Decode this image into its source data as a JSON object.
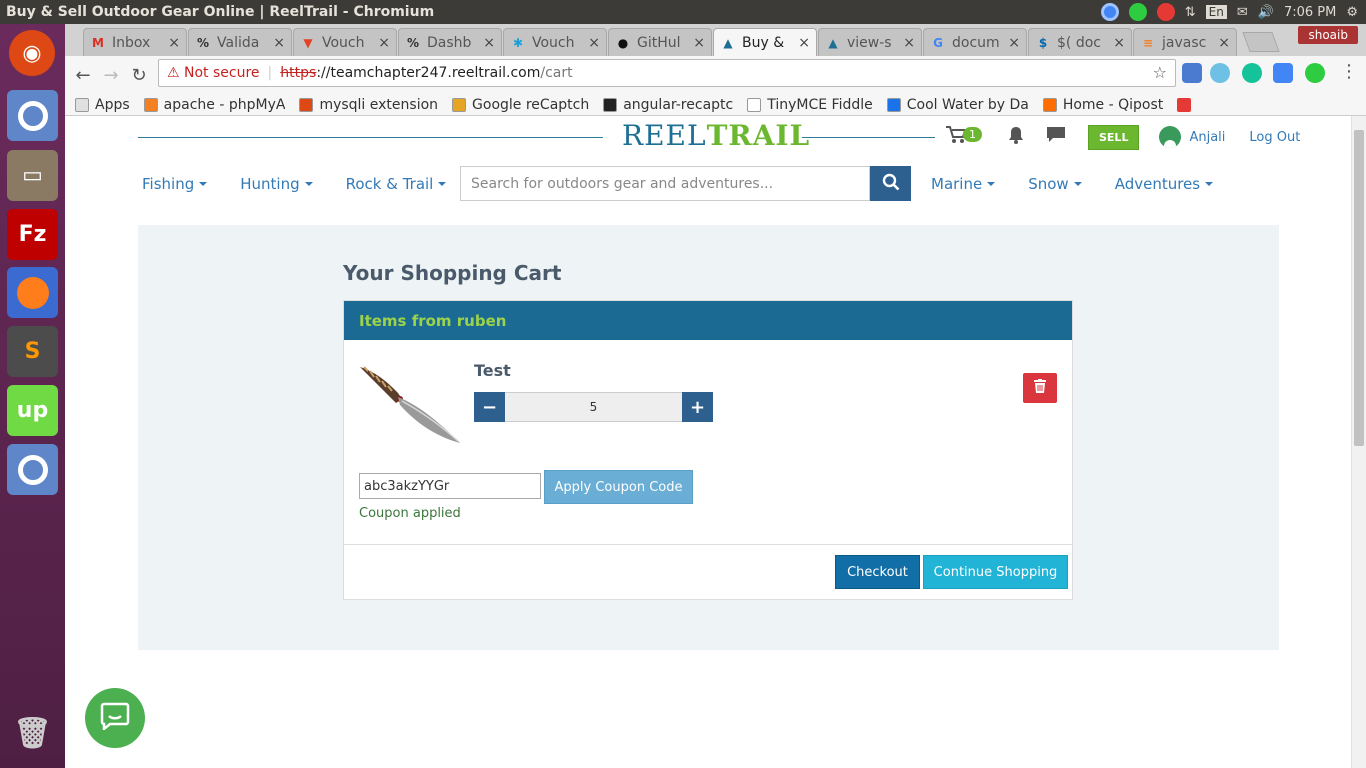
{
  "os": {
    "window_title": "Buy & Sell Outdoor Gear Online | ReelTrail - Chromium",
    "lang": "En",
    "time": "7:06 PM"
  },
  "browser": {
    "tabs": [
      {
        "label": "Inbox",
        "icon": "gmail-icon",
        "active": false
      },
      {
        "label": "Valida",
        "icon": "percent-icon",
        "active": false
      },
      {
        "label": "Vouch",
        "icon": "gitlab-icon",
        "active": false
      },
      {
        "label": "Dashb",
        "icon": "percent-icon",
        "active": false
      },
      {
        "label": "Vouch",
        "icon": "puzzle-icon",
        "active": false
      },
      {
        "label": "GitHul",
        "icon": "github-icon",
        "active": false
      },
      {
        "label": "Buy &",
        "icon": "reeltrail-icon",
        "active": true
      },
      {
        "label": "view-s",
        "icon": "reeltrail-icon",
        "active": false
      },
      {
        "label": "docum",
        "icon": "google-icon",
        "active": false
      },
      {
        "label": "$( doc",
        "icon": "jquery-icon",
        "active": false
      },
      {
        "label": "javasc",
        "icon": "stackoverflow-icon",
        "active": false
      }
    ],
    "profile": "shoaib",
    "not_secure": "Not secure",
    "url_scheme": "https",
    "url_host": "://teamchapter247.reeltrail.com",
    "url_path": "/cart",
    "bookmarks": [
      {
        "label": "Apps",
        "color": "#e0e0e0"
      },
      {
        "label": "apache - phpMyA",
        "color": "#f48024"
      },
      {
        "label": "mysqli extension",
        "color": "#dd4814"
      },
      {
        "label": "Google reCaptch",
        "color": "#e5a423"
      },
      {
        "label": "angular-recaptc",
        "color": "#222222"
      },
      {
        "label": "TinyMCE Fiddle",
        "color": "#ffffff"
      },
      {
        "label": "Cool Water by Da",
        "color": "#1a73e8"
      },
      {
        "label": "Home - Qipost",
        "color": "#ff6d00"
      }
    ]
  },
  "site": {
    "logo_reel": "REEL",
    "logo_trail": "TRAIL",
    "cart_count": "1",
    "sell_label": "SELL",
    "user_name": "Anjali",
    "logout_label": "Log Out",
    "nav_left": [
      "Fishing",
      "Hunting",
      "Rock & Trail"
    ],
    "search_placeholder": "Search for outdoors gear and adventures...",
    "nav_right": [
      "Marine",
      "Snow",
      "Adventures"
    ]
  },
  "cart": {
    "title": "Your Shopping Cart",
    "seller_header": "Items from ruben",
    "item_name": "Test",
    "quantity": "5",
    "coupon_value": "abc3akzYYGr",
    "apply_label": "Apply Coupon Code",
    "coupon_message": "Coupon applied",
    "checkout_label": "Checkout",
    "continue_label": "Continue Shopping"
  },
  "colors": {
    "brand_blue": "#1e6f94",
    "brand_green": "#6bb72f",
    "panel_header": "#1b6a93",
    "delete_red": "#d9363e"
  }
}
